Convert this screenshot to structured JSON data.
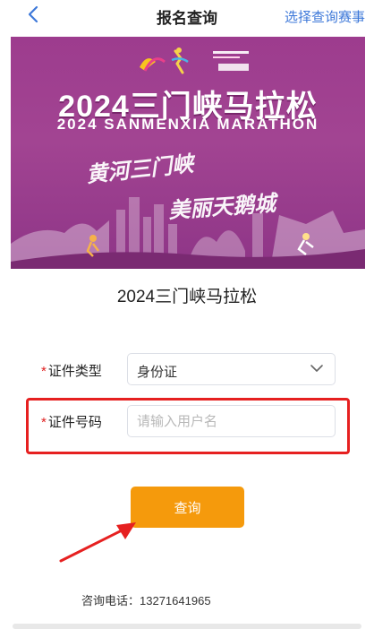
{
  "header": {
    "title": "报名查询",
    "select_event_link": "选择查询赛事"
  },
  "banner": {
    "title_cn": "2024三门峡马拉松",
    "title_en": "2024 SANMENXIA MARATHON",
    "slogan_1": "黄河三门峡",
    "slogan_2": "美丽天鹅城",
    "brand_color": "#9d3c8e"
  },
  "event": {
    "name": "2024三门峡马拉松"
  },
  "form": {
    "id_type": {
      "required_mark": "*",
      "label": "证件类型",
      "value": "身份证"
    },
    "id_number": {
      "required_mark": "*",
      "label": "证件号码",
      "placeholder": "请输入用户名",
      "value": ""
    },
    "submit_label": "查询"
  },
  "footer": {
    "contact_label": "咨询电话：",
    "contact_phone": "13271641965"
  },
  "colors": {
    "accent": "#f59a0c",
    "link": "#3d78d9",
    "required": "#e02020",
    "annotation": "#e62020"
  }
}
